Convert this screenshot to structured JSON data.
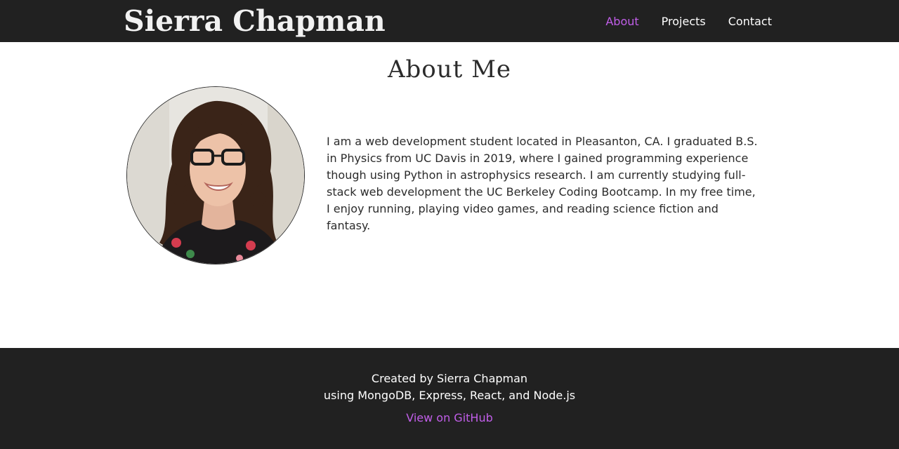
{
  "header": {
    "site_title": "Sierra Chapman",
    "nav": [
      {
        "label": "About",
        "active": true
      },
      {
        "label": "Projects",
        "active": false
      },
      {
        "label": "Contact",
        "active": false
      }
    ],
    "bg_color": "#212121",
    "accent_color": "#c15ee9"
  },
  "main": {
    "heading": "About Me",
    "bio": "I am a web development student located in Pleasanton, CA. I graduated B.S. in Physics from UC Davis in 2019, where I gained programming experience though using Python in astrophysics research. I am currently studying full-stack web development the UC Berkeley Coding Bootcamp. In my free time, I enjoy running, playing video games, and reading science fiction and fantasy."
  },
  "footer": {
    "line1": "Created by Sierra Chapman",
    "line2": "using MongoDB, Express, React, and Node.js",
    "github_link": "View on GitHub"
  }
}
